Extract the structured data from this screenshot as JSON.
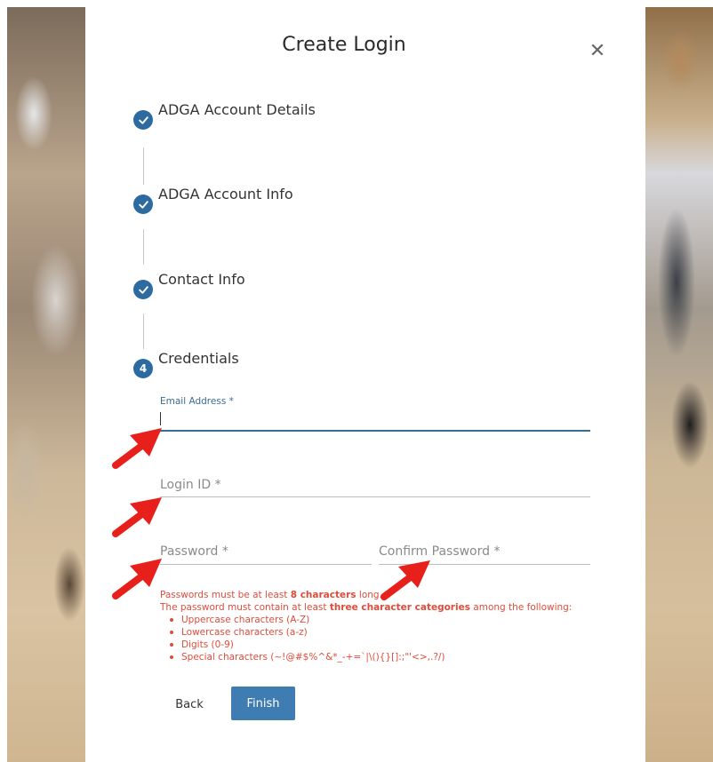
{
  "dialog": {
    "title": "Create Login",
    "close_icon": "close-icon"
  },
  "steps": [
    {
      "label": "ADGA Account Details",
      "state": "complete"
    },
    {
      "label": "ADGA Account Info",
      "state": "complete"
    },
    {
      "label": "Contact Info",
      "state": "complete"
    },
    {
      "label": "Credentials",
      "state": "current",
      "number": "4"
    }
  ],
  "form": {
    "email_label": "Email Address *",
    "email_value": "",
    "login_label": "Login ID *",
    "password_label": "Password *",
    "confirm_label": "Confirm Password *"
  },
  "rules": {
    "line1_pre": "Passwords must be at least ",
    "line1_bold": "8 characters",
    "line1_post": " long.",
    "line2_pre": "The password must contain at least ",
    "line2_bold": "three character categories",
    "line2_post": " among the following:",
    "items": [
      "Uppercase characters (A-Z)",
      "Lowercase characters (a-z)",
      "Digits (0-9)",
      "Special characters (~!@#$%^&*_-+=`|\\(){}[]:;\"'<>,.?/)"
    ]
  },
  "buttons": {
    "back": "Back",
    "finish": "Finish"
  },
  "colors": {
    "accent": "#2d6aa0",
    "button": "#3f7cb2",
    "error": "#e04b3a",
    "annotation_arrow": "#e8201c"
  }
}
